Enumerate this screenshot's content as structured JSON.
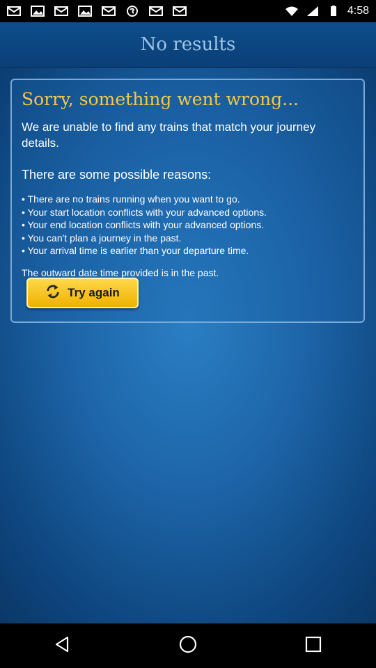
{
  "status_bar": {
    "time": "4:58",
    "left_icons": [
      "mail-icon",
      "image-icon",
      "mail-icon",
      "image-icon",
      "mail-icon",
      "shazam-icon",
      "mail-icon",
      "mail-icon"
    ],
    "right_icons": [
      "wifi-icon",
      "signal-icon",
      "battery-icon"
    ]
  },
  "header": {
    "title": "No results"
  },
  "panel": {
    "heading": "Sorry, something went wrong...",
    "intro": "We are unable to find any trains that match your journey details.",
    "reasons_title": "There are some possible reasons:",
    "reasons": [
      "There are no trains running when you want to go.",
      "Your start location conflicts with your advanced options.",
      "Your end location conflicts with your advanced options.",
      "You can't plan a journey in the past.",
      "Your arrival time is earlier than your departure time."
    ],
    "note": "The outward date time provided is in the past.",
    "button_label": "Try again",
    "button_icon": "refresh-icon"
  },
  "nav": [
    "back-icon",
    "home-icon",
    "recents-icon"
  ],
  "colors": {
    "heading": "#f5c842",
    "title": "#9fc4e6",
    "button": "#f0b000",
    "background": "#1d65a8"
  }
}
